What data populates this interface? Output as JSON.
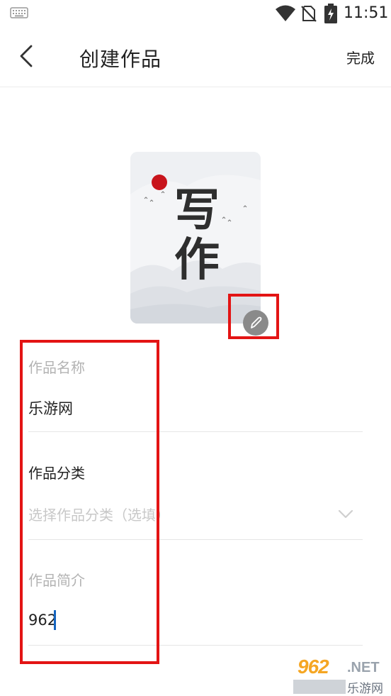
{
  "status_bar": {
    "time": "11:51"
  },
  "header": {
    "title": "创建作品",
    "done_label": "完成"
  },
  "cover": {
    "title_text": "写作"
  },
  "form": {
    "name_label": "作品名称",
    "name_value": "乐游网",
    "category_label": "作品分类",
    "category_placeholder": "选择作品分类（选填）",
    "intro_label": "作品简介",
    "intro_value": "962"
  },
  "watermark": {
    "brand": "962",
    "suffix": ".NET",
    "site_name": "乐游网"
  },
  "colors": {
    "annotation": "#e31414",
    "caret": "#1565c0",
    "muted_text": "#b3b3b3"
  }
}
